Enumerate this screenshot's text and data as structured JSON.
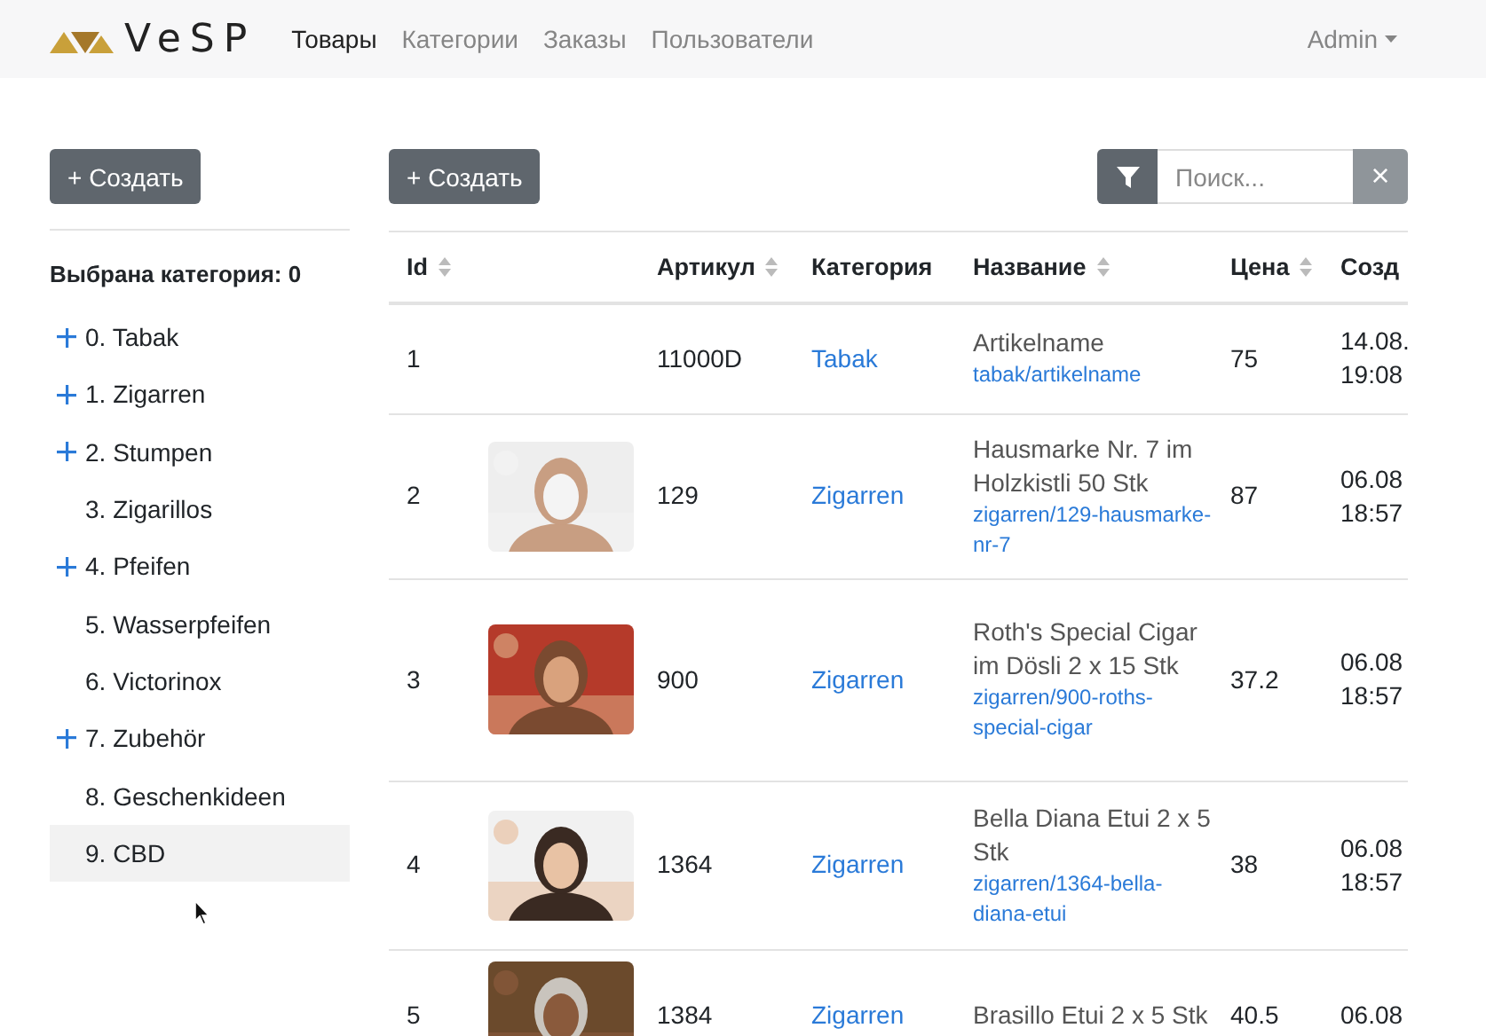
{
  "brand": {
    "name": "VeSP"
  },
  "nav": [
    {
      "label": "Товары",
      "selected": true
    },
    {
      "label": "Категории",
      "selected": false
    },
    {
      "label": "Заказы",
      "selected": false
    },
    {
      "label": "Пользователи",
      "selected": false
    }
  ],
  "user_menu": {
    "label": "Admin"
  },
  "sidebar": {
    "create_button": "+ Создать",
    "heading": "Выбрана категория: 0",
    "items": [
      {
        "label": "0. Tabak",
        "expandable": true,
        "hovered": false
      },
      {
        "label": "1. Zigarren",
        "expandable": true,
        "hovered": false
      },
      {
        "label": "2. Stumpen",
        "expandable": true,
        "hovered": false
      },
      {
        "label": "3. Zigarillos",
        "expandable": false,
        "hovered": false
      },
      {
        "label": "4. Pfeifen",
        "expandable": true,
        "hovered": false
      },
      {
        "label": "5. Wasserpfeifen",
        "expandable": false,
        "hovered": false
      },
      {
        "label": "6. Victorinox",
        "expandable": false,
        "hovered": false
      },
      {
        "label": "7. Zubehör",
        "expandable": true,
        "hovered": false
      },
      {
        "label": "8. Geschenkideen",
        "expandable": false,
        "hovered": false
      },
      {
        "label": "9. CBD",
        "expandable": false,
        "hovered": true
      }
    ]
  },
  "toolbar": {
    "create_button": "+ Создать",
    "search": {
      "placeholder": "Поиск..."
    },
    "clear_button": "×"
  },
  "table": {
    "columns": [
      {
        "label": "Id",
        "sortable": true
      },
      {
        "label": "Артикул",
        "sortable": true
      },
      {
        "label": "Категория",
        "sortable": false
      },
      {
        "label": "Название",
        "sortable": true
      },
      {
        "label": "Цена",
        "sortable": true
      },
      {
        "label": "Созд",
        "sortable": false
      }
    ],
    "rows": [
      {
        "id": "1",
        "article": "11000D",
        "category": "Tabak",
        "name": "Artikelname",
        "slug": "tabak/artikelname",
        "price": "75",
        "created": [
          "14.08.",
          "19:08"
        ]
      },
      {
        "id": "2",
        "thumbnail": {
          "kind": "picture"
        },
        "article": "129",
        "category": "Zigarren",
        "name": "Hausmarke Nr. 7 im Holzkistli 50 Stk",
        "slug": "zigarren/129-hausmarke-nr-7",
        "price": "87",
        "created": [
          "06.08",
          "18:57"
        ]
      },
      {
        "id": "3",
        "thumbnail": {
          "kind": "picture"
        },
        "article": "900",
        "category": "Zigarren",
        "name": "Roth's Special Cigar im Dösli 2 x 15 Stk",
        "slug": "zigarren/900-roths-special-cigar",
        "price": "37.2",
        "created": [
          "06.08",
          "18:57"
        ]
      },
      {
        "id": "4",
        "thumbnail": {
          "kind": "picture"
        },
        "article": "1364",
        "category": "Zigarren",
        "name": "Bella Diana Etui 2 x 5 Stk",
        "slug": "zigarren/1364-bella-diana-etui",
        "price": "38",
        "created": [
          "06.08",
          "18:57"
        ]
      },
      {
        "id": "5",
        "thumbnail": {
          "kind": "picture"
        },
        "article": "1384",
        "category": "Zigarren",
        "name": "Brasillo Etui 2 x 5 Stk",
        "price": "40.5",
        "created": [
          "06.08"
        ]
      }
    ]
  }
}
